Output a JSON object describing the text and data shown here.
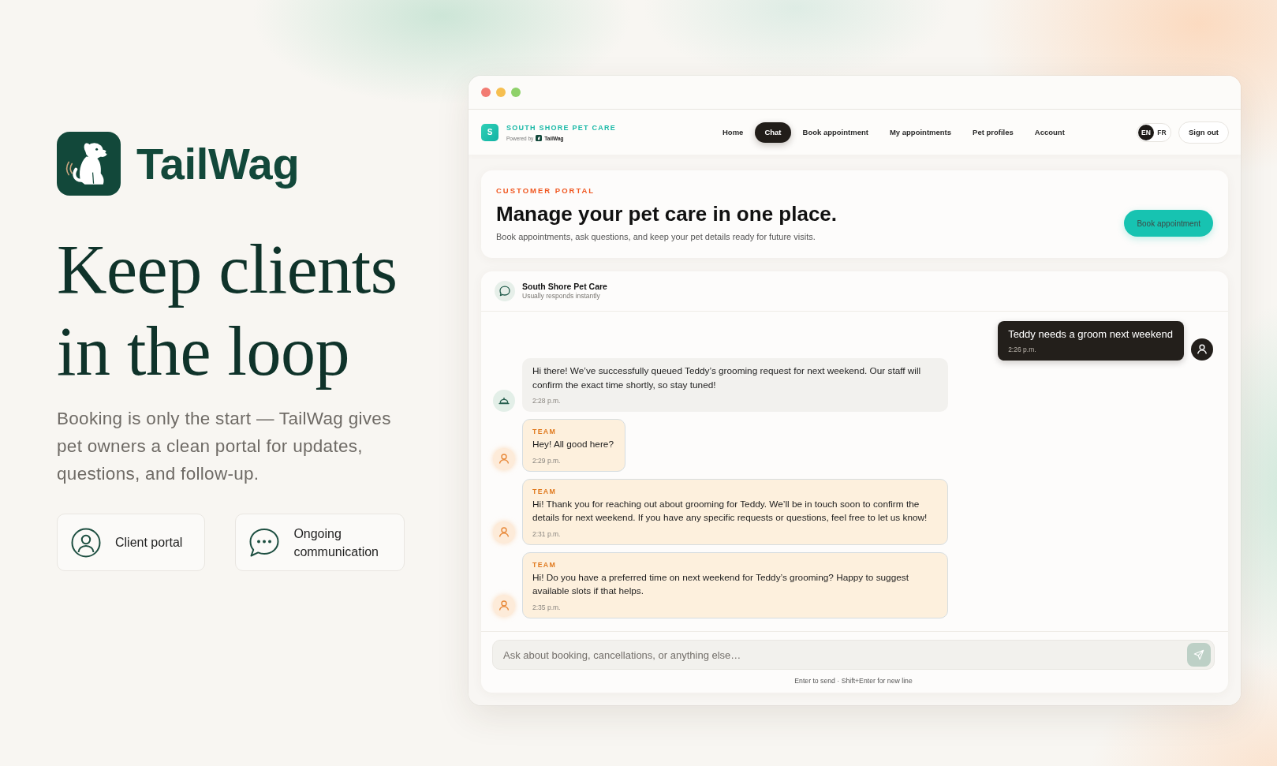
{
  "brand": {
    "name": "TailWag",
    "headline": "Keep clients in the loop",
    "intro": "Booking is only the start — TailWag gives pet owners a clean portal for updates, questions, and follow-up."
  },
  "features": [
    {
      "kind": "profile",
      "label": "Client portal"
    },
    {
      "kind": "chat",
      "label": "Ongoing communication"
    }
  ],
  "app": {
    "clinic": {
      "logo_letter": "S",
      "name": "SOUTH SHORE PET CARE",
      "powered_by": "Powered by",
      "platform": "TailWag"
    },
    "nav": [
      {
        "label": "Home",
        "selected": false
      },
      {
        "label": "Chat",
        "selected": true
      },
      {
        "label": "Book appointment",
        "selected": false
      },
      {
        "label": "My appointments",
        "selected": false
      },
      {
        "label": "Pet profiles",
        "selected": false
      },
      {
        "label": "Account",
        "selected": false
      }
    ],
    "languages": [
      {
        "label": "EN",
        "selected": true
      },
      {
        "label": "FR",
        "selected": false
      }
    ],
    "sign_out": "Sign out",
    "hero": {
      "eyebrow": "CUSTOMER PORTAL",
      "title": "Manage your pet care in one place.",
      "subtitle": "Book appointments, ask questions, and keep your pet details ready for future visits.",
      "button": "Book appointment"
    },
    "chat": {
      "contact": "South Shore Pet Care",
      "status": "Usually responds instantly",
      "messages": [
        {
          "kind": "user",
          "text": "Teddy needs a groom next weekend",
          "time": "2:26 p.m."
        },
        {
          "kind": "assistant",
          "text": "Hi there! We’ve successfully queued Teddy’s grooming request for next weekend. Our staff will confirm the exact time shortly, so stay tuned!",
          "time": "2:28 p.m."
        },
        {
          "kind": "team",
          "tag": "TEAM",
          "text": "Hey! All good here?",
          "time": "2:29 p.m."
        },
        {
          "kind": "team",
          "tag": "TEAM",
          "text": "Hi! Thank you for reaching out about grooming for Teddy. We’ll be in touch soon to confirm the details for next weekend. If you have any specific requests or questions, feel free to let us know!",
          "time": "2:31 p.m."
        },
        {
          "kind": "team",
          "tag": "TEAM",
          "text": "Hi! Do you have a preferred time on next weekend for Teddy’s grooming? Happy to suggest available slots if that helps.",
          "time": "2:35 p.m."
        }
      ],
      "input": {
        "placeholder": "Ask about booking, cancellations, or anything else…"
      },
      "send_button": {
        "disabled": true
      },
      "hint": "Enter to send · Shift+Enter for new line"
    }
  }
}
